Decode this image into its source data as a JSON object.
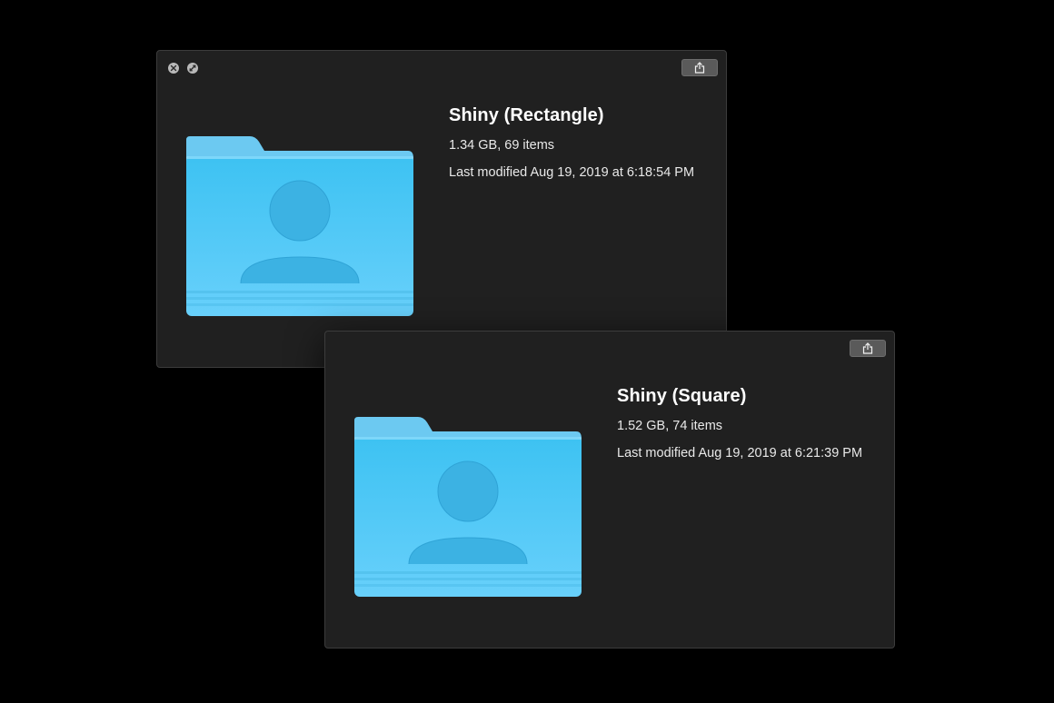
{
  "windows": [
    {
      "title": "Shiny (Rectangle)",
      "summary": "1.34 GB, 69 items",
      "modified": "Last modified Aug 19, 2019 at 6:18:54 PM",
      "controls": [
        "close-icon",
        "fullscreen-icon"
      ],
      "share_icon": "share-icon",
      "folder_icon": "user-folder-icon"
    },
    {
      "title": "Shiny (Square)",
      "summary": "1.52 GB, 74 items",
      "modified": "Last modified Aug 19, 2019 at 6:21:39 PM",
      "share_icon": "share-icon",
      "folder_icon": "user-folder-icon"
    }
  ],
  "colors": {
    "background": "#000000",
    "window": "#202020",
    "folder_blue": "#5cc8f5",
    "folder_tab": "#6cc9f1"
  }
}
